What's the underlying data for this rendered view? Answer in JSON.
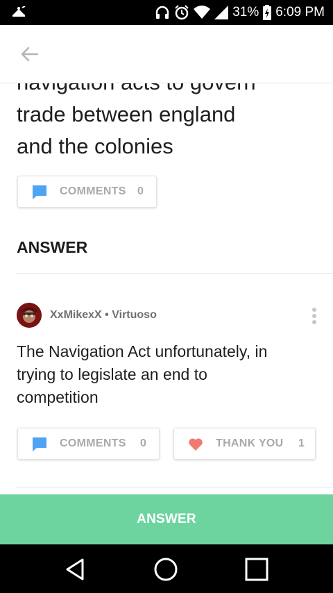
{
  "status_bar": {
    "battery": "31%",
    "time": "6:09 PM"
  },
  "question": {
    "lines": [
      "navigation acts to govern",
      "trade between england",
      "and the colonies"
    ]
  },
  "question_comments": {
    "label": "COMMENTS",
    "count": "0"
  },
  "answer_section": {
    "title": "ANSWER"
  },
  "answer": {
    "author": "XxMikexX",
    "separator": "•",
    "rank": "Virtuoso",
    "text_lines": [
      "The Navigation Act unfortunately, in",
      "trying to legislate an end to",
      "competition"
    ],
    "comments": {
      "label": "COMMENTS",
      "count": "0"
    },
    "thanks": {
      "label": "THANK YOU",
      "count": "1"
    }
  },
  "answer_button": {
    "label": "ANSWER"
  },
  "colors": {
    "accent_green": "#6dd4a0",
    "comment_icon_blue": "#4ea4f2",
    "heart_red": "#f07a72"
  },
  "icons": [
    "notification-icon",
    "headphones-icon",
    "alarm-icon",
    "wifi-icon",
    "signal-icon",
    "battery-icon",
    "back-arrow-icon",
    "comment-icon",
    "heart-icon",
    "more-vertical-icon",
    "nav-back-icon",
    "nav-home-icon",
    "nav-recents-icon"
  ]
}
